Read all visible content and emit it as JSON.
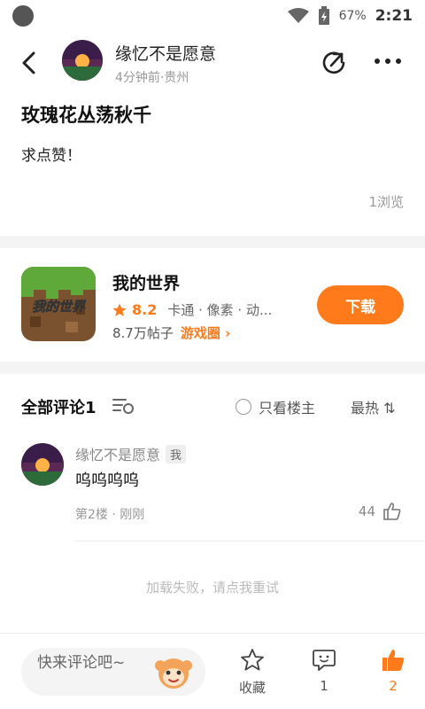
{
  "status_bar": {
    "battery": "67%",
    "time": "2:21"
  },
  "header": {
    "author_name": "缘忆不是愿意",
    "author_meta": "4分钟前·贵州"
  },
  "post": {
    "title": "玫瑰花丛荡秋千",
    "body": "求点赞！",
    "views": "1浏览"
  },
  "game": {
    "name": "我的世界",
    "icon_text": "我的世界",
    "rating": "8.2",
    "tags": "卡通 · 像素 · 动...",
    "posts": "8.7万帖子",
    "circle_link": "游戏圈",
    "download_label": "下载"
  },
  "comments": {
    "header_label": "全部评论1",
    "only_owner_label": "只看楼主",
    "sort_label": "最热",
    "items": [
      {
        "name": "缘忆不是愿意",
        "badge": "我",
        "text": "呜呜呜呜",
        "meta": "第2楼 · 刚刚",
        "likes": "44"
      }
    ],
    "load_fail": "加载失败，请点我重试"
  },
  "bottom_bar": {
    "input_placeholder": "快来评论吧~",
    "favorite_label": "收藏",
    "comment_count": "1",
    "like_count": "2"
  },
  "colors": {
    "accent": "#ff7a1a",
    "divider": "#f4f4f4"
  }
}
